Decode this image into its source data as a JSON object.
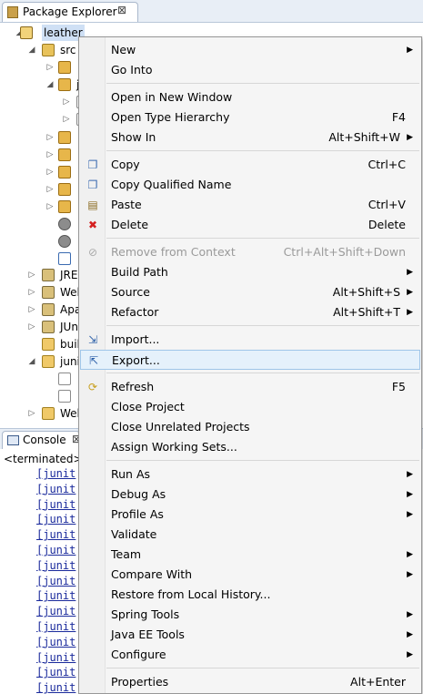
{
  "package_explorer": {
    "title": "Package Explorer",
    "close_glyph": "⊠",
    "tree": [
      {
        "label": "leather",
        "icon": "project-icon",
        "selected": true
      },
      {
        "label": "src",
        "icon": "source-folder-icon"
      },
      {
        "label": "",
        "icon": "package-icon"
      },
      {
        "label": "j",
        "icon": "package-icon"
      },
      {
        "label": "",
        "icon": "file-icon"
      },
      {
        "label": "",
        "icon": "file-icon"
      },
      {
        "label": "",
        "icon": "package-icon"
      },
      {
        "label": "",
        "icon": "package-icon"
      },
      {
        "label": "",
        "icon": "package-icon"
      },
      {
        "label": "",
        "icon": "package-icon"
      },
      {
        "label": "",
        "icon": "package-icon"
      },
      {
        "label": "",
        "icon": "gear-icon"
      },
      {
        "label": "",
        "icon": "gear-icon"
      },
      {
        "label": "",
        "icon": "xml-file-icon"
      },
      {
        "label": "JRE",
        "icon": "library-icon"
      },
      {
        "label": "Wel",
        "icon": "library-icon"
      },
      {
        "label": "Apa",
        "icon": "library-icon"
      },
      {
        "label": "JUn",
        "icon": "library-icon"
      },
      {
        "label": "buil",
        "icon": "folder-icon"
      },
      {
        "label": "juni",
        "icon": "folder-icon"
      },
      {
        "label": "",
        "icon": "file-icon"
      },
      {
        "label": "",
        "icon": "file-icon"
      },
      {
        "label": "Wel",
        "icon": "folder-icon"
      }
    ]
  },
  "console": {
    "title": "Console",
    "close_glyph": "⊠",
    "status": "<terminated>",
    "lines": [
      "[junit",
      "[junit",
      "[junit",
      "[junit",
      "[junit",
      "[junit",
      "[junit",
      "[junit",
      "[junit",
      "[junit",
      "[junit",
      "[junit",
      "[junit",
      "[junit",
      "[junit"
    ]
  },
  "context_menu": {
    "items": [
      {
        "label": "New",
        "shortcut": "",
        "submenu": true
      },
      {
        "label": "Go Into",
        "shortcut": ""
      },
      {
        "separator": true
      },
      {
        "label": "Open in New Window",
        "shortcut": ""
      },
      {
        "label": "Open Type Hierarchy",
        "shortcut": "F4"
      },
      {
        "label": "Show In",
        "shortcut": "Alt+Shift+W",
        "submenu": true
      },
      {
        "separator": true
      },
      {
        "label": "Copy",
        "shortcut": "Ctrl+C",
        "icon": "copy-icon"
      },
      {
        "label": "Copy Qualified Name",
        "shortcut": "",
        "icon": "copy-qualified-icon"
      },
      {
        "label": "Paste",
        "shortcut": "Ctrl+V",
        "icon": "paste-icon"
      },
      {
        "label": "Delete",
        "shortcut": "Delete",
        "icon": "delete-icon"
      },
      {
        "separator": true
      },
      {
        "label": "Remove from Context",
        "shortcut": "Ctrl+Alt+Shift+Down",
        "icon": "remove-context-icon",
        "disabled": true
      },
      {
        "label": "Build Path",
        "shortcut": "",
        "submenu": true
      },
      {
        "label": "Source",
        "shortcut": "Alt+Shift+S",
        "submenu": true
      },
      {
        "label": "Refactor",
        "shortcut": "Alt+Shift+T",
        "submenu": true
      },
      {
        "separator": true
      },
      {
        "label": "Import...",
        "shortcut": "",
        "icon": "import-icon"
      },
      {
        "label": "Export...",
        "shortcut": "",
        "icon": "export-icon",
        "hover": true
      },
      {
        "separator": true
      },
      {
        "label": "Refresh",
        "shortcut": "F5",
        "icon": "refresh-icon"
      },
      {
        "label": "Close Project",
        "shortcut": ""
      },
      {
        "label": "Close Unrelated Projects",
        "shortcut": ""
      },
      {
        "label": "Assign Working Sets...",
        "shortcut": ""
      },
      {
        "separator": true
      },
      {
        "label": "Run As",
        "shortcut": "",
        "submenu": true
      },
      {
        "label": "Debug As",
        "shortcut": "",
        "submenu": true
      },
      {
        "label": "Profile As",
        "shortcut": "",
        "submenu": true
      },
      {
        "label": "Validate",
        "shortcut": ""
      },
      {
        "label": "Team",
        "shortcut": "",
        "submenu": true
      },
      {
        "label": "Compare With",
        "shortcut": "",
        "submenu": true
      },
      {
        "label": "Restore from Local History...",
        "shortcut": ""
      },
      {
        "label": "Spring Tools",
        "shortcut": "",
        "submenu": true
      },
      {
        "label": "Java EE Tools",
        "shortcut": "",
        "submenu": true
      },
      {
        "label": "Configure",
        "shortcut": "",
        "submenu": true
      },
      {
        "separator": true
      },
      {
        "label": "Properties",
        "shortcut": "Alt+Enter"
      }
    ]
  },
  "colors": {
    "menu_bg": "#f5f5f5",
    "hover_bg": "#e5f1fb",
    "disabled_text": "#9a9a9a",
    "console_link": "#1a2a9c"
  }
}
